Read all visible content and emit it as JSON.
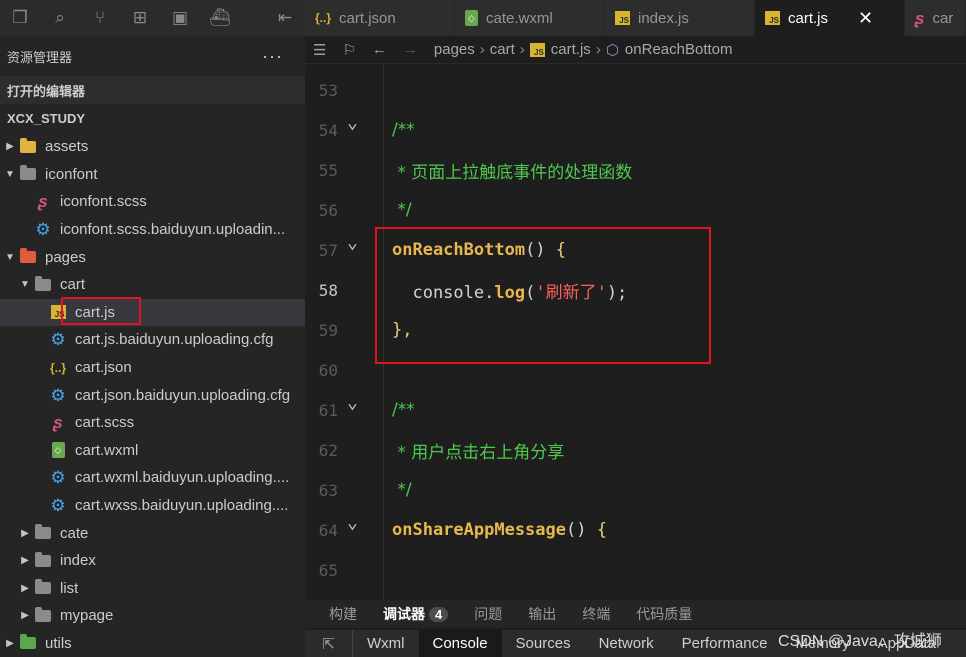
{
  "sidebar": {
    "title": "资源管理器",
    "more": "···",
    "open_editors": "打开的编辑器",
    "project": "XCX_STUDY",
    "tree": [
      {
        "label": "assets",
        "indent": 0,
        "twisty": "▶",
        "icon": "folder-yellow"
      },
      {
        "label": "iconfont",
        "indent": 0,
        "twisty": "▼",
        "icon": "folder"
      },
      {
        "label": "iconfont.scss",
        "indent": 1,
        "twisty": "",
        "icon": "scss"
      },
      {
        "label": "iconfont.scss.baiduyun.uploadin...",
        "indent": 1,
        "twisty": "",
        "icon": "gear"
      },
      {
        "label": "pages",
        "indent": 0,
        "twisty": "▼",
        "icon": "folder-red"
      },
      {
        "label": "cart",
        "indent": 1,
        "twisty": "▼",
        "icon": "folder"
      },
      {
        "label": "cart.js",
        "indent": 2,
        "twisty": "",
        "icon": "js",
        "selected": true
      },
      {
        "label": "cart.js.baiduyun.uploading.cfg",
        "indent": 2,
        "twisty": "",
        "icon": "gear"
      },
      {
        "label": "cart.json",
        "indent": 2,
        "twisty": "",
        "icon": "json"
      },
      {
        "label": "cart.json.baiduyun.uploading.cfg",
        "indent": 2,
        "twisty": "",
        "icon": "gear"
      },
      {
        "label": "cart.scss",
        "indent": 2,
        "twisty": "",
        "icon": "scss"
      },
      {
        "label": "cart.wxml",
        "indent": 2,
        "twisty": "",
        "icon": "wxml"
      },
      {
        "label": "cart.wxml.baiduyun.uploading....",
        "indent": 2,
        "twisty": "",
        "icon": "gear"
      },
      {
        "label": "cart.wxss.baiduyun.uploading....",
        "indent": 2,
        "twisty": "",
        "icon": "gear"
      },
      {
        "label": "cate",
        "indent": 1,
        "twisty": "▶",
        "icon": "folder"
      },
      {
        "label": "index",
        "indent": 1,
        "twisty": "▶",
        "icon": "folder"
      },
      {
        "label": "list",
        "indent": 1,
        "twisty": "▶",
        "icon": "folder"
      },
      {
        "label": "mypage",
        "indent": 1,
        "twisty": "▶",
        "icon": "folder"
      },
      {
        "label": "utils",
        "indent": 0,
        "twisty": "▶",
        "icon": "folder-green"
      }
    ]
  },
  "tabs": [
    {
      "label": "cart.json",
      "icon": "json"
    },
    {
      "label": "cate.wxml",
      "icon": "wxml"
    },
    {
      "label": "index.js",
      "icon": "js"
    },
    {
      "label": "cart.js",
      "icon": "js",
      "active": true,
      "close": "✕"
    },
    {
      "label": "car",
      "icon": "scss"
    }
  ],
  "breadcrumb": {
    "parts": [
      "pages",
      "cart",
      "cart.js",
      "onReachBottom"
    ]
  },
  "editor": {
    "lines": [
      {
        "n": "53",
        "fold": false,
        "tokens": []
      },
      {
        "n": "54",
        "fold": true,
        "tokens": [
          {
            "t": "/**",
            "c": "cmt"
          }
        ]
      },
      {
        "n": "55",
        "fold": false,
        "tokens": [
          {
            "t": " * 页面上拉触底事件的处理函数",
            "c": "cmt"
          }
        ]
      },
      {
        "n": "56",
        "fold": false,
        "tokens": [
          {
            "t": " */",
            "c": "cmt"
          }
        ]
      },
      {
        "n": "57",
        "fold": true,
        "tokens": [
          {
            "t": "onReachBottom",
            "c": "fn"
          },
          {
            "t": "() ",
            "c": "pun"
          },
          {
            "t": "{",
            "c": "brace"
          }
        ]
      },
      {
        "n": "58",
        "fold": false,
        "current": true,
        "tokens": [
          {
            "t": "  console.",
            "c": "pun"
          },
          {
            "t": "log",
            "c": "fn"
          },
          {
            "t": "(",
            "c": "pun"
          },
          {
            "t": "'刷新了'",
            "c": "str"
          },
          {
            "t": ");",
            "c": "pun"
          }
        ]
      },
      {
        "n": "59",
        "fold": false,
        "tokens": [
          {
            "t": "},",
            "c": "brace"
          }
        ]
      },
      {
        "n": "60",
        "fold": false,
        "tokens": []
      },
      {
        "n": "61",
        "fold": true,
        "tokens": [
          {
            "t": "/**",
            "c": "cmt"
          }
        ]
      },
      {
        "n": "62",
        "fold": false,
        "tokens": [
          {
            "t": " * 用户点击右上角分享",
            "c": "cmt"
          }
        ]
      },
      {
        "n": "63",
        "fold": false,
        "tokens": [
          {
            "t": " */",
            "c": "cmt"
          }
        ]
      },
      {
        "n": "64",
        "fold": true,
        "tokens": [
          {
            "t": "onShareAppMessage",
            "c": "fn"
          },
          {
            "t": "() ",
            "c": "pun"
          },
          {
            "t": "{",
            "c": "brace"
          }
        ]
      },
      {
        "n": "65",
        "fold": false,
        "tokens": []
      }
    ]
  },
  "panel": {
    "tabs": [
      "构建",
      "调试器",
      "问题",
      "输出",
      "终端",
      "代码质量"
    ],
    "active": "调试器",
    "badge": "4"
  },
  "devtools": {
    "tabs": [
      "Wxml",
      "Console",
      "Sources",
      "Network",
      "Performance",
      "Memory",
      "AppData"
    ],
    "active": "Console"
  },
  "watermark": "CSDN @Java、攻城狮"
}
